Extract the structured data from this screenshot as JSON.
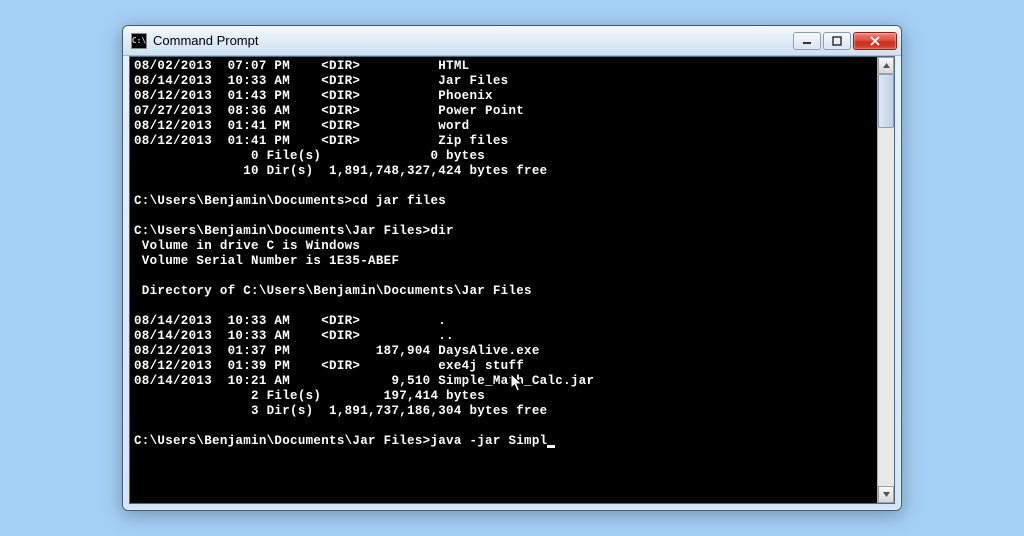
{
  "window": {
    "title": "Command Prompt",
    "icon_label": "C:\\"
  },
  "terminal": {
    "lines": [
      "08/02/2013  07:07 PM    <DIR>          HTML",
      "08/14/2013  10:33 AM    <DIR>          Jar Files",
      "08/12/2013  01:43 PM    <DIR>          Phoenix",
      "07/27/2013  08:36 AM    <DIR>          Power Point",
      "08/12/2013  01:41 PM    <DIR>          word",
      "08/12/2013  01:41 PM    <DIR>          Zip files",
      "               0 File(s)              0 bytes",
      "              10 Dir(s)  1,891,748,327,424 bytes free",
      "",
      "C:\\Users\\Benjamin\\Documents>cd jar files",
      "",
      "C:\\Users\\Benjamin\\Documents\\Jar Files>dir",
      " Volume in drive C is Windows",
      " Volume Serial Number is 1E35-ABEF",
      "",
      " Directory of C:\\Users\\Benjamin\\Documents\\Jar Files",
      "",
      "08/14/2013  10:33 AM    <DIR>          .",
      "08/14/2013  10:33 AM    <DIR>          ..",
      "08/12/2013  01:37 PM           187,904 DaysAlive.exe",
      "08/12/2013  01:39 PM    <DIR>          exe4j stuff",
      "08/14/2013  10:21 AM             9,510 Simple_Math_Calc.jar",
      "               2 File(s)        197,414 bytes",
      "               3 Dir(s)  1,891,737,186,304 bytes free",
      ""
    ],
    "prompt": "C:\\Users\\Benjamin\\Documents\\Jar Files>",
    "input": "java -jar Simpl"
  }
}
